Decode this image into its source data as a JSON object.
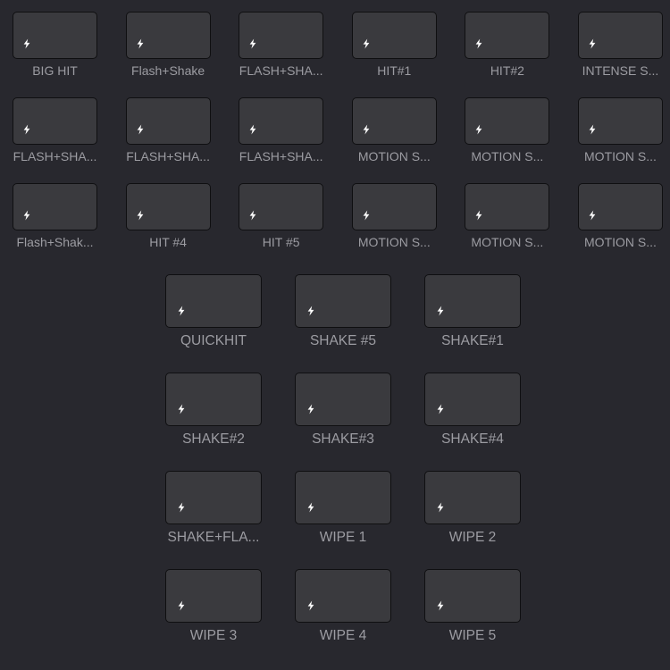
{
  "colors": {
    "background": "#28282e",
    "tile_fill": "#3a3a3e",
    "tile_border": "#0f0f11",
    "label_text": "#9c9ca2",
    "icon": "#ffffff"
  },
  "tile_icon": "lightning-bolt-icon",
  "top_grid": {
    "items": [
      {
        "label": "BIG HIT"
      },
      {
        "label": "Flash+Shake"
      },
      {
        "label": "FLASH+SHA..."
      },
      {
        "label": "HIT#1"
      },
      {
        "label": "HIT#2"
      },
      {
        "label": "INTENSE S..."
      },
      {
        "label": "FLASH+SHA..."
      },
      {
        "label": "FLASH+SHA..."
      },
      {
        "label": "FLASH+SHA..."
      },
      {
        "label": "MOTION S..."
      },
      {
        "label": "MOTION S..."
      },
      {
        "label": "MOTION S..."
      },
      {
        "label": "Flash+Shak..."
      },
      {
        "label": "HIT #4"
      },
      {
        "label": "HIT #5"
      },
      {
        "label": "MOTION S..."
      },
      {
        "label": "MOTION S..."
      },
      {
        "label": "MOTION S..."
      }
    ]
  },
  "bottom_grid": {
    "items": [
      {
        "label": "QUICKHIT"
      },
      {
        "label": "SHAKE #5"
      },
      {
        "label": "SHAKE#1"
      },
      {
        "label": "SHAKE#2"
      },
      {
        "label": "SHAKE#3"
      },
      {
        "label": "SHAKE#4"
      },
      {
        "label": "SHAKE+FLA..."
      },
      {
        "label": "WIPE 1"
      },
      {
        "label": "WIPE 2"
      },
      {
        "label": "WIPE 3"
      },
      {
        "label": "WIPE 4"
      },
      {
        "label": "WIPE 5"
      }
    ]
  }
}
